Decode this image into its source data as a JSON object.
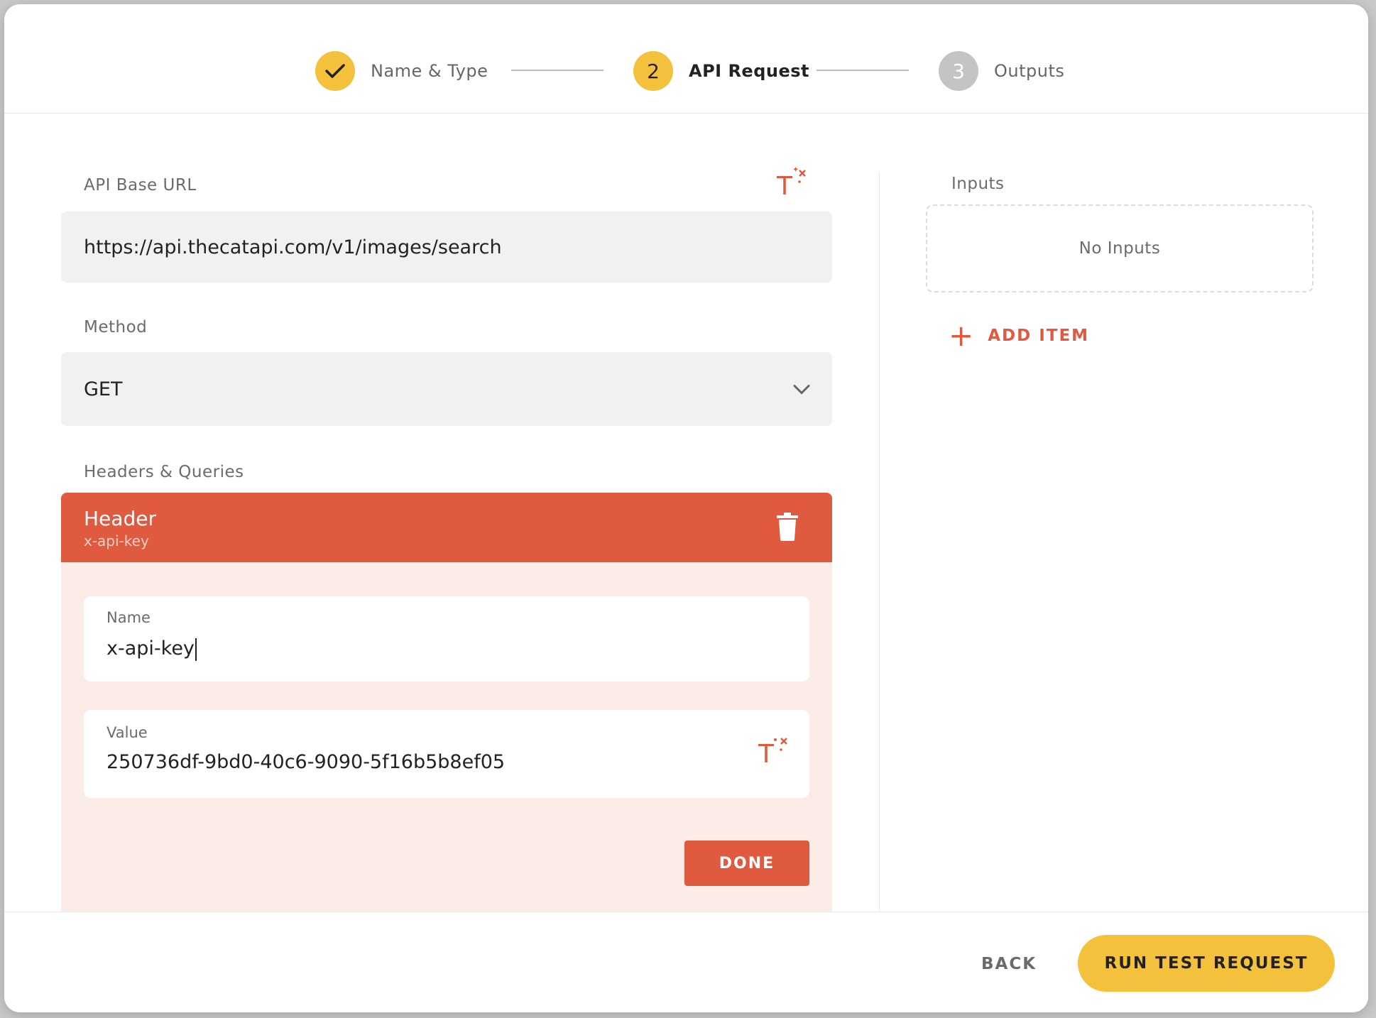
{
  "stepper": {
    "steps": [
      {
        "number": "",
        "label": "Name & Type",
        "state": "done"
      },
      {
        "number": "2",
        "label": "API Request",
        "state": "active"
      },
      {
        "number": "3",
        "label": "Outputs",
        "state": "pending"
      }
    ]
  },
  "api_base_url": {
    "label": "API Base URL",
    "value": "https://api.thecatapi.com/v1/images/search"
  },
  "method": {
    "label": "Method",
    "value": "GET"
  },
  "headers_queries": {
    "label": "Headers & Queries",
    "item": {
      "type": "Header",
      "subtitle": "x-api-key",
      "name_label": "Name",
      "name_value": "x-api-key",
      "value_label": "Value",
      "value_value": "250736df-9bd0-40c6-9090-5f16b5b8ef05",
      "done_label": "DONE"
    }
  },
  "inputs": {
    "label": "Inputs",
    "empty_text": "No Inputs",
    "add_label": "ADD ITEM"
  },
  "footer": {
    "back_label": "BACK",
    "run_label": "RUN TEST REQUEST"
  },
  "colors": {
    "accent_orange": "#e05a3f",
    "accent_yellow": "#f3c13c",
    "header_body_bg": "#fbece8"
  }
}
